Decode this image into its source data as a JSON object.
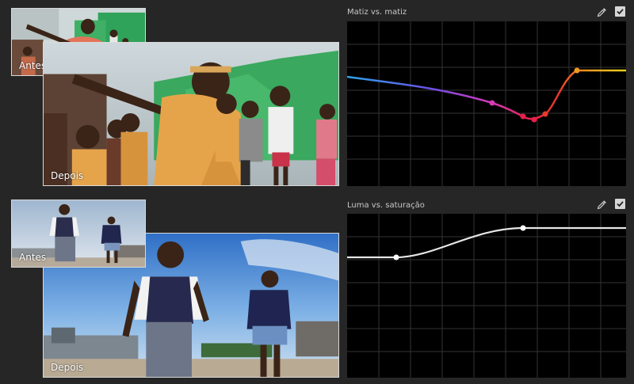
{
  "colors": {
    "background": "#262626",
    "panel": "#000000",
    "grid": "#333333",
    "frame": "#d9d9d9"
  },
  "comparisons": [
    {
      "before_label": "Antes",
      "after_label": "Depois"
    },
    {
      "before_label": "Antes",
      "after_label": "Depois"
    }
  ],
  "curves": [
    {
      "title": "Matiz vs. matiz",
      "icons": [
        "eyedropper-icon",
        "checkbox-checked-icon"
      ],
      "enabled": true
    },
    {
      "title": "Luma vs. saturação",
      "icons": [
        "eyedropper-icon",
        "checkbox-checked-icon"
      ],
      "enabled": true
    }
  ]
}
